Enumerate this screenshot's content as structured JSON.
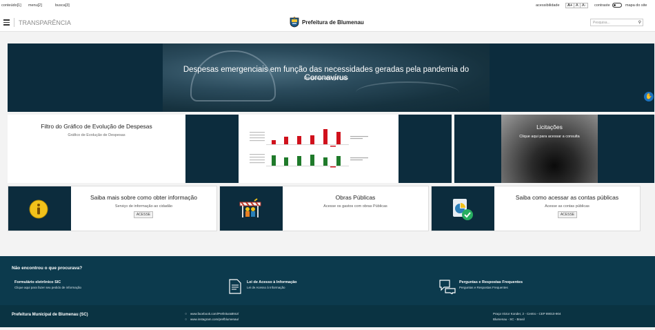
{
  "skip_links": [
    "conteúdo[1]",
    "menu[2]",
    "busca[3]"
  ],
  "accessibility": {
    "label": "acessibilidade",
    "font_increase": "A+",
    "font_default": "A",
    "font_decrease": "A-",
    "contrast_label": "contraste",
    "sitemap_label": "mapa do site"
  },
  "header": {
    "section": "TRANSPARÊNCIA",
    "brand": "Prefeitura de Blumenau",
    "search_placeholder": "Pesquisa..."
  },
  "hero": {
    "title": "Despesas emergenciais em função das necessidades geradas pela pandemia do Coronavírus",
    "subtitle": "Despesas emergenciais"
  },
  "filtro_card": {
    "title": "Filtro do Gráfico de Evolução de Despesas",
    "subtitle": "Gráfico de Evolução de Despesas"
  },
  "licitacoes_card": {
    "title": "Licitações",
    "subtitle": "Clique aqui para acessar a consulta"
  },
  "info_cards": [
    {
      "title": "Saiba mais sobre como obter informação",
      "subtitle": "Serviço de informação ao cidadão",
      "button": "ACESSE",
      "icon": "info-icon"
    },
    {
      "title": "Obras Públicas",
      "subtitle": "Acesse os gastos com obras Públicas",
      "icon": "construction-icon"
    },
    {
      "title": "Saiba como acessar as contas públicas",
      "subtitle": "Acesse as contas públicas",
      "button": "ACESSE",
      "icon": "accounts-check-icon"
    }
  ],
  "footer": {
    "question": "Não encontrou o que procurava?",
    "columns": [
      {
        "title": "Formulário eletrônico SIC",
        "desc": "Clique aqui para fazer seu pedido de informação",
        "icon": "form-icon"
      },
      {
        "title": "Lei de Acesso à Informação",
        "desc": "Lei de Acesso à Informação",
        "icon": "document-icon"
      },
      {
        "title": "Perguntas e Respostas Frequentes",
        "desc": "Perguntas e Respostas Frequentes",
        "icon": "faq-chat-icon"
      }
    ],
    "org": "Prefeitura Municipal de Blumenau (SC)",
    "social": [
      "www.facebook.com/PrefeituraBNU/",
      "www.instagram.com/prefblumenau/"
    ],
    "address": [
      "Praça Victor Konder, 2 - Centro - CEP 89010-904",
      "Blumenau - SC - Brasil"
    ]
  },
  "colors": {
    "navy": "#0c2c3d",
    "footer": "#0c3a4d",
    "bar_red": "#d0111c",
    "bar_green": "#1f7a2a"
  }
}
